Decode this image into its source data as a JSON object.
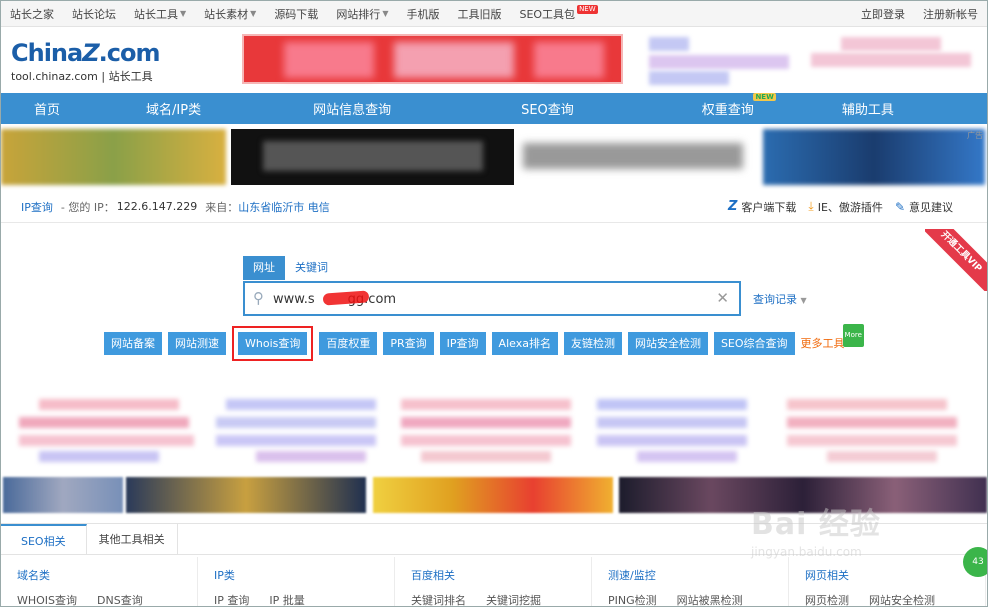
{
  "topbar": {
    "links": [
      {
        "label": "站长之家",
        "caret": false
      },
      {
        "label": "站长论坛",
        "caret": false
      },
      {
        "label": "站长工具",
        "caret": true
      },
      {
        "label": "站长素材",
        "caret": true
      },
      {
        "label": "源码下载",
        "caret": false
      },
      {
        "label": "网站排行",
        "caret": true
      },
      {
        "label": "手机版",
        "caret": false
      },
      {
        "label": "工具旧版",
        "caret": false
      },
      {
        "label": "SEO工具包",
        "caret": false,
        "badge": "NEW"
      }
    ],
    "login": "立即登录",
    "register": "注册新帐号"
  },
  "logo": {
    "brand_pre": "China",
    "brand_z": "Z",
    "brand_post": ".com",
    "subtitle": "tool.chinaz.com | 站长工具"
  },
  "nav": {
    "items": [
      "首页",
      "域名/IP类",
      "网站信息查询",
      "SEO查询",
      "权重查询",
      "辅助工具"
    ],
    "new_badge": "NEW",
    "new_on_index": 4,
    "bg_color": "#3a8fd0"
  },
  "ad_label": "广告",
  "infobar": {
    "ip_query": "IP查询",
    "your_ip_label": "- 您的 IP：",
    "ip": "122.6.147.229",
    "from_label": "来自：",
    "location": "山东省临沂市 电信",
    "client_download": "客户端下载",
    "plugin": "IE、傲游插件",
    "feedback": "意见建议"
  },
  "search": {
    "tabs": [
      "网址",
      "关键词"
    ],
    "active_tab": 0,
    "input_value": "www.s        gg.com",
    "history": "查询记录",
    "buttons": [
      "网站备案",
      "网站测速",
      "Whois查询",
      "百度权重",
      "PR查询",
      "IP查询",
      "Alexa排名",
      "友链检测",
      "网站安全检测",
      "SEO综合查询"
    ],
    "highlighted_button": "Whois查询",
    "more_tools": "更多工具",
    "more_badge": "More",
    "vip_ribbon": "开通工具VIP"
  },
  "categories": {
    "tabs": [
      "SEO相关",
      "其他工具相关"
    ],
    "columns": [
      {
        "title": "域名类",
        "links": [
          "WHOIS查询",
          "DNS查询"
        ]
      },
      {
        "title": "IP类",
        "links": [
          "IP 查询",
          "IP 批量"
        ]
      },
      {
        "title": "百度相关",
        "links": [
          "关键词排名",
          "关键词挖掘"
        ]
      },
      {
        "title": "测速/监控",
        "links": [
          "PING检测",
          "网站被黑检测"
        ]
      },
      {
        "title": "网页相关",
        "links": [
          "网页检测",
          "网站安全检测"
        ]
      }
    ]
  },
  "watermark": {
    "text": "Bai 经验",
    "url": "jingyan.baidu.com"
  },
  "float_badge": "43"
}
